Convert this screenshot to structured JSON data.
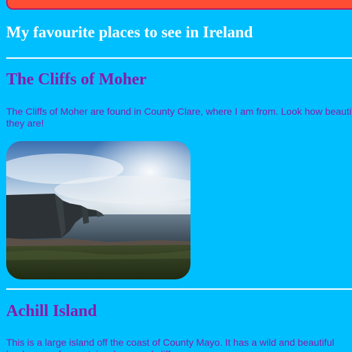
{
  "header": {
    "title": "My favourite places to see in Ireland"
  },
  "sections": [
    {
      "title": "The Cliffs of Moher",
      "text": "The Cliffs of Moher are found in County Clare, where I am from. Look how beautiful they are!"
    },
    {
      "title": "Achill Island",
      "text": "This is a large island off the coast of County Mayo. It has a wild and beautiful landscape of mountains, bogs and cliffs."
    }
  ],
  "colors": {
    "background": "#00bfff",
    "heading_text": "#ffffff",
    "section_text": "#8b1aa8",
    "banner": "#ff4d33"
  },
  "icons": {
    "photo": "cliffs-of-moher-photo"
  }
}
